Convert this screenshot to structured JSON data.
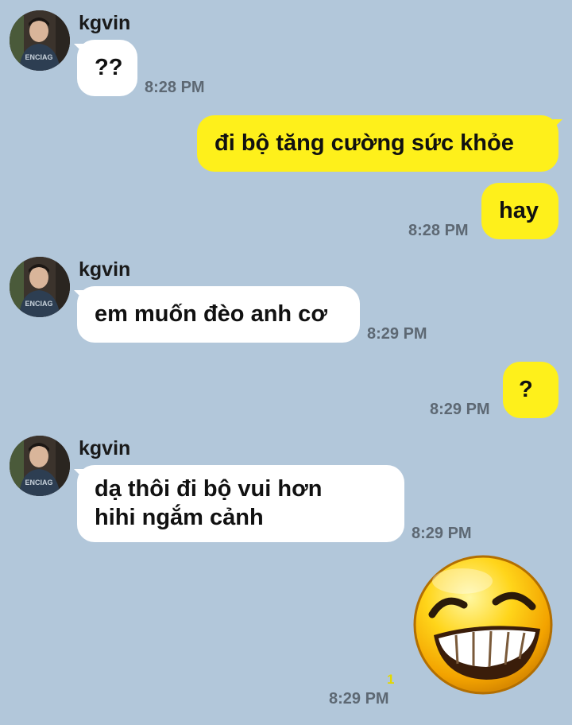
{
  "contact": {
    "name": "kgvin"
  },
  "messages": [
    {
      "from": "them",
      "text": "??",
      "time": "8:28 PM"
    },
    {
      "from": "me",
      "text": "đi bộ tăng cường sức khỏe"
    },
    {
      "from": "me",
      "text": "hay",
      "time": "8:28 PM"
    },
    {
      "from": "them",
      "text": "em muốn đèo anh cơ",
      "time": "8:29 PM"
    },
    {
      "from": "me",
      "text": "?",
      "time": "8:29 PM"
    },
    {
      "from": "them",
      "lines": [
        "dạ thôi đi bộ vui hơn",
        "hihi ngắm cảnh"
      ],
      "time": "8:29 PM"
    },
    {
      "from": "me",
      "type": "emoticon",
      "icon": "laughing-emoji-sticker",
      "unread": "1",
      "time": "8:29 PM"
    }
  ],
  "colors": {
    "background": "#b2c7da",
    "incoming_bubble": "#ffffff",
    "outgoing_bubble": "#fef01b",
    "timestamp": "#5d6873",
    "unread_count": "#e3d800"
  }
}
